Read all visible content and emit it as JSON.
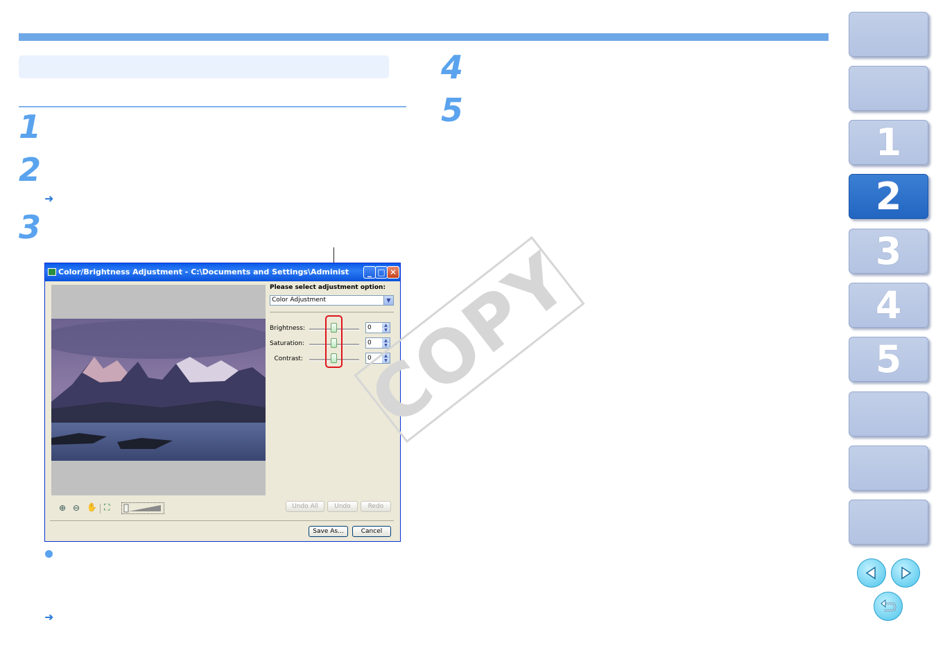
{
  "steps": [
    "1",
    "2",
    "3",
    "4",
    "5"
  ],
  "arrow_glyph": "➜",
  "watermark": "COPY",
  "sidebar": {
    "tabs": [
      {
        "label": "",
        "active": false
      },
      {
        "label": "",
        "active": false
      },
      {
        "label": "1",
        "active": false
      },
      {
        "label": "2",
        "active": true
      },
      {
        "label": "3",
        "active": false
      },
      {
        "label": "4",
        "active": false
      },
      {
        "label": "5",
        "active": false
      },
      {
        "label": "",
        "active": false
      },
      {
        "label": "",
        "active": false
      },
      {
        "label": "",
        "active": false
      }
    ]
  },
  "window": {
    "title": "Color/Brightness Adjustment - C:\\Documents and Settings\\Administrator\\My Documents\\M...",
    "minimize": "_",
    "maximize": "□",
    "close": "✕",
    "option_label": "Please select adjustment option:",
    "option_value": "Color Adjustment",
    "sliders": [
      {
        "label": "Brightness:",
        "value": "0"
      },
      {
        "label": "Saturation:",
        "value": "0"
      },
      {
        "label": "Contrast:",
        "value": "0"
      }
    ],
    "buttons": {
      "undo_all": "Undo All",
      "undo": "Undo",
      "redo": "Redo",
      "save_as": "Save As...",
      "cancel": "Cancel"
    }
  },
  "colors": {
    "accent": "#5aa3ee",
    "tab": "#b3c3e2",
    "tab_active": "#2266c2",
    "highlight": "#e0141c"
  }
}
